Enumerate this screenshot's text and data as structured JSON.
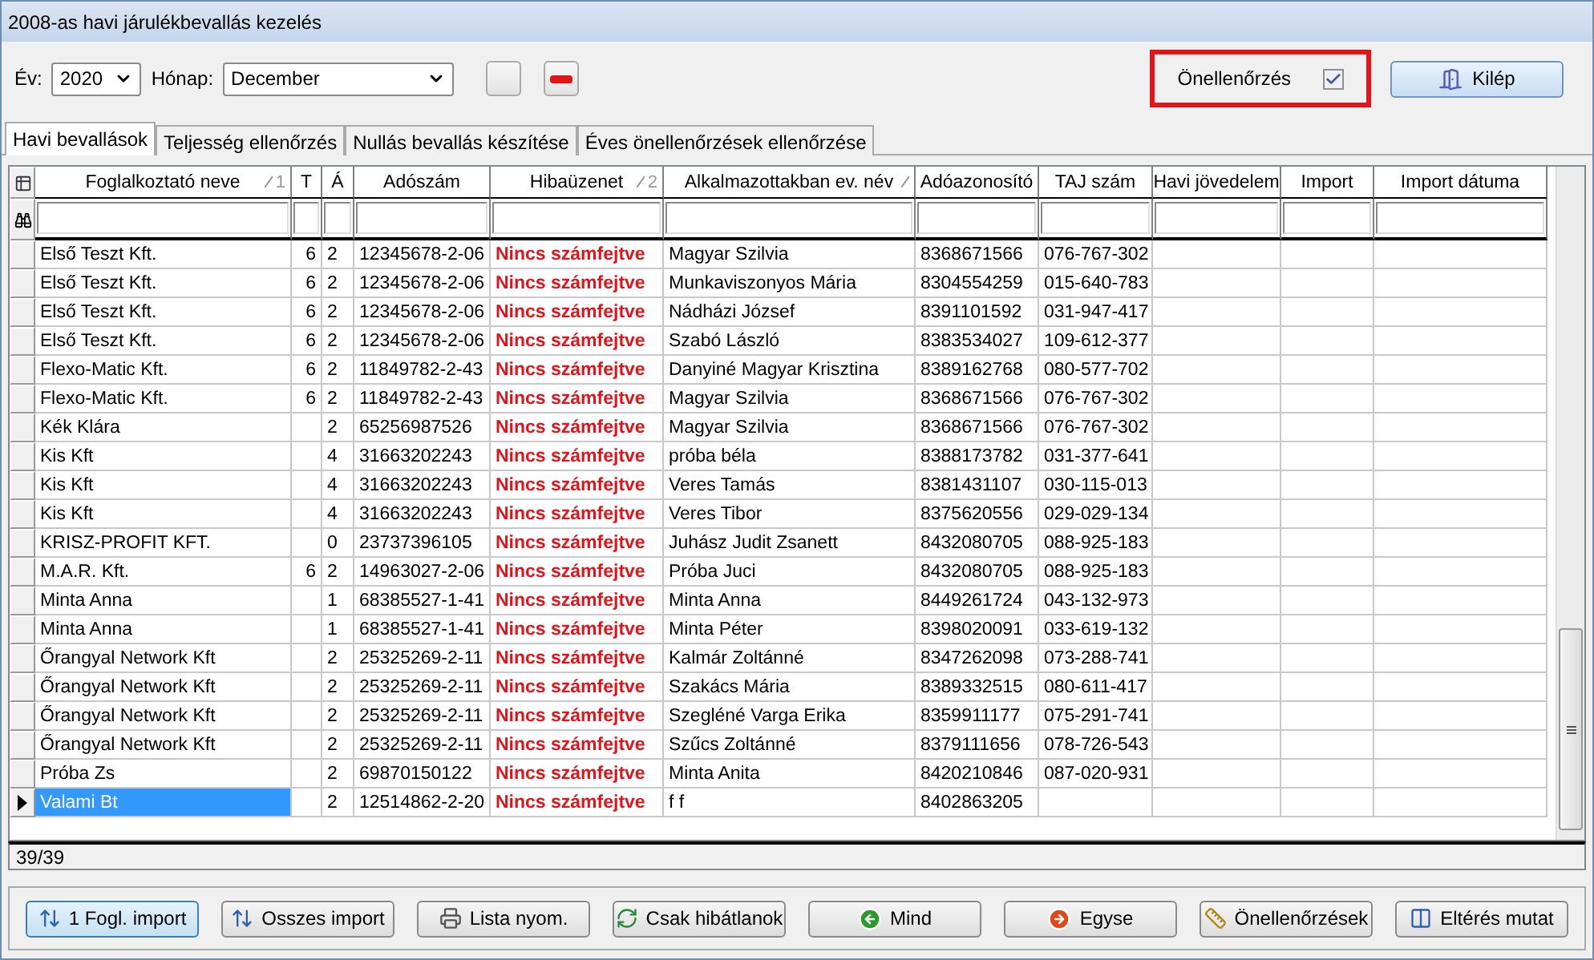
{
  "window": {
    "title": "2008-as havi járulékbevallás kezelés"
  },
  "toolbar": {
    "year_label": "Év:",
    "year": "2020",
    "month_label": "Hónap:",
    "month": "December",
    "self_check": {
      "label": "Önellenőrzés",
      "checked": true,
      "highlighted": true
    },
    "exit_button": "Kilép"
  },
  "tabs": [
    {
      "label": "Havi bevallások",
      "selected": true
    },
    {
      "label": "Teljesség ellenőrzés",
      "selected": false
    },
    {
      "label": "Nullás bevallás készítése",
      "selected": false
    },
    {
      "label": "Éves önellenőrzések ellenőrzése",
      "selected": false
    }
  ],
  "table": {
    "columns": [
      {
        "label": "Foglalkoztató neve",
        "sorted": true,
        "sort_order": "1"
      },
      {
        "label": "T",
        "sorted": false
      },
      {
        "label": "Á",
        "sorted": false
      },
      {
        "label": "Adószám",
        "sorted": false
      },
      {
        "label": "Hibaüzenet",
        "sorted": true,
        "sort_order": "2"
      },
      {
        "label": "Alkalmazottakban ev. név",
        "sorted": true
      },
      {
        "label": "Adóazonosító",
        "sorted": false
      },
      {
        "label": "TAJ szám",
        "sorted": false
      },
      {
        "label": "Havi jövedelem",
        "sorted": false
      },
      {
        "label": "Import",
        "sorted": false
      },
      {
        "label": "Import dátuma",
        "sorted": false
      }
    ],
    "rows": [
      {
        "cells": [
          "Első Teszt Kft.",
          "6",
          "2",
          "12345678-2-06",
          "Nincs számfejtve",
          "Magyar  Szilvia",
          "8368671566",
          "076-767-302"
        ],
        "selected": false
      },
      {
        "cells": [
          "Első Teszt Kft.",
          "6",
          "2",
          "12345678-2-06",
          "Nincs számfejtve",
          "Munkaviszonyos Mária",
          "8304554259",
          "015-640-783"
        ],
        "selected": false
      },
      {
        "cells": [
          "Első Teszt Kft.",
          "6",
          "2",
          "12345678-2-06",
          "Nincs számfejtve",
          "Nádházi  József",
          "8391101592",
          "031-947-417"
        ],
        "selected": false
      },
      {
        "cells": [
          "Első Teszt Kft.",
          "6",
          "2",
          "12345678-2-06",
          "Nincs számfejtve",
          "Szabó László",
          "8383534027",
          "109-612-377"
        ],
        "selected": false
      },
      {
        "cells": [
          "Flexo-Matic Kft.",
          "6",
          "2",
          "11849782-2-43",
          "Nincs számfejtve",
          "Danyiné Magyar Krisztina",
          "8389162768",
          "080-577-702"
        ],
        "selected": false
      },
      {
        "cells": [
          "Flexo-Matic Kft.",
          "6",
          "2",
          "11849782-2-43",
          "Nincs számfejtve",
          "Magyar  Szilvia",
          "8368671566",
          "076-767-302"
        ],
        "selected": false
      },
      {
        "cells": [
          "Kék Klára",
          "",
          "2",
          "65256987526",
          "Nincs számfejtve",
          "Magyar  Szilvia",
          "8368671566",
          "076-767-302"
        ],
        "selected": false
      },
      {
        "cells": [
          "Kis Kft",
          "",
          "4",
          "31663202243",
          "Nincs számfejtve",
          "próba béla",
          "8388173782",
          "031-377-641"
        ],
        "selected": false
      },
      {
        "cells": [
          "Kis Kft",
          "",
          "4",
          "31663202243",
          "Nincs számfejtve",
          "Veres Tamás",
          "8381431107",
          "030-115-013"
        ],
        "selected": false
      },
      {
        "cells": [
          "Kis Kft",
          "",
          "4",
          "31663202243",
          "Nincs számfejtve",
          "Veres Tibor",
          "8375620556",
          "029-029-134"
        ],
        "selected": false
      },
      {
        "cells": [
          "KRISZ-PROFIT KFT.",
          "",
          "0",
          "23737396105",
          "Nincs számfejtve",
          "Juhász Judit Zsanett",
          "8432080705",
          "088-925-183"
        ],
        "selected": false
      },
      {
        "cells": [
          "M.A.R. Kft.",
          "6",
          "2",
          "14963027-2-06",
          "Nincs számfejtve",
          "Próba Juci",
          "8432080705",
          "088-925-183"
        ],
        "selected": false
      },
      {
        "cells": [
          "Minta Anna",
          "",
          "1",
          "68385527-1-41",
          "Nincs számfejtve",
          "Minta Anna",
          "8449261724",
          "043-132-973"
        ],
        "selected": false
      },
      {
        "cells": [
          "Minta Anna",
          "",
          "1",
          "68385527-1-41",
          "Nincs számfejtve",
          "Minta Péter",
          "8398020091",
          "033-619-132"
        ],
        "selected": false
      },
      {
        "cells": [
          "Őrangyal Network Kft",
          "",
          "2",
          "25325269-2-11",
          "Nincs számfejtve",
          "Kalmár Zoltánné",
          "8347262098",
          "073-288-741"
        ],
        "selected": false
      },
      {
        "cells": [
          "Őrangyal Network Kft",
          "",
          "2",
          "25325269-2-11",
          "Nincs számfejtve",
          "Szakács Mária",
          "8389332515",
          "080-611-417"
        ],
        "selected": false
      },
      {
        "cells": [
          "Őrangyal Network Kft",
          "",
          "2",
          "25325269-2-11",
          "Nincs számfejtve",
          "Szegléné Varga Erika",
          "8359911177",
          "075-291-741"
        ],
        "selected": false
      },
      {
        "cells": [
          "Őrangyal Network Kft",
          "",
          "2",
          "25325269-2-11",
          "Nincs számfejtve",
          "Szűcs Zoltánné",
          "8379111656",
          "078-726-543"
        ],
        "selected": false
      },
      {
        "cells": [
          "Próba Zs",
          "",
          "2",
          "69870150122",
          "Nincs számfejtve",
          "Minta  Anita",
          "8420210846",
          "087-020-931"
        ],
        "selected": false
      },
      {
        "cells": [
          "Valami Bt",
          "",
          "2",
          "12514862-2-20",
          "Nincs számfejtve",
          "f f",
          "8402863205",
          ""
        ],
        "selected": true
      }
    ]
  },
  "status_bar": {
    "count": "39/39"
  },
  "buttons": [
    {
      "label": "1 Fogl. import",
      "kind": "import",
      "focused": true
    },
    {
      "label": "Osszes import",
      "kind": "import",
      "focused": false
    },
    {
      "label": "Lista nyom.",
      "kind": "print",
      "focused": false
    },
    {
      "label": "Csak hibátlanok",
      "kind": "refresh",
      "focused": false
    },
    {
      "label": "Mind",
      "kind": "back",
      "focused": false
    },
    {
      "label": "Egyse",
      "kind": "forward",
      "focused": false
    },
    {
      "label": "Önellenőrzések",
      "kind": "ruler",
      "focused": false
    },
    {
      "label": "Eltérés mutat",
      "kind": "compare",
      "focused": false
    }
  ]
}
